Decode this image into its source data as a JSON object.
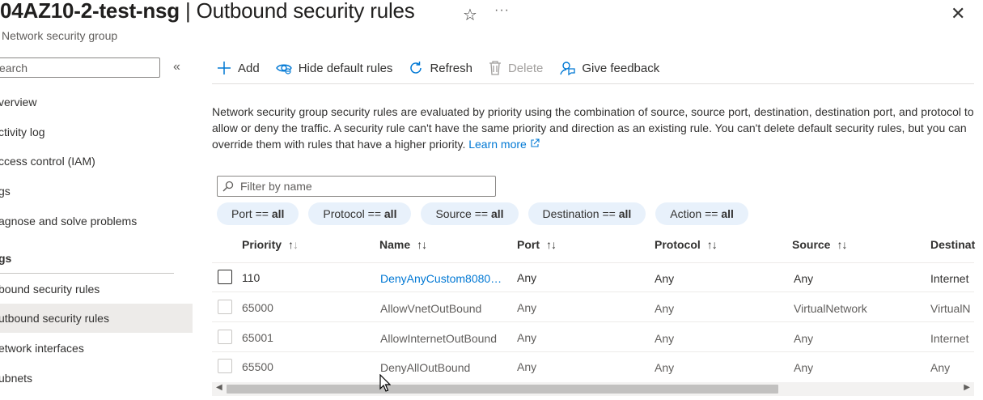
{
  "header": {
    "title_bold": "04AZ10-2-test-nsg",
    "title_rest": " | Outbound security rules",
    "subtitle": "Network security group",
    "star_glyph": "☆",
    "more_glyph": "···",
    "close_glyph": "✕"
  },
  "nav": {
    "search_placeholder": "earch",
    "collapse_glyph": "«",
    "items": [
      {
        "label": "verview"
      },
      {
        "label": "ctivity log"
      },
      {
        "label": "ccess control (IAM)"
      },
      {
        "label": "gs"
      },
      {
        "label": "agnose and solve problems"
      },
      {
        "label": "gs"
      },
      {
        "label": "bound security rules"
      },
      {
        "label": "utbound security rules"
      },
      {
        "label": "etwork interfaces"
      },
      {
        "label": "ubnets"
      }
    ]
  },
  "toolbar": {
    "add": "Add",
    "hide_default": "Hide default rules",
    "refresh": "Refresh",
    "delete": "Delete",
    "feedback": "Give feedback"
  },
  "description": {
    "text": "Network security group security rules are evaluated by priority using the combination of source, source port, destination, destination port, and protocol to allow or deny the traffic. A security rule can't have the same priority and direction as an existing rule. You can't delete default security rules, but you can override them with rules that have a higher priority. ",
    "learn_more": "Learn more"
  },
  "filter": {
    "placeholder": "Filter by name"
  },
  "pills": [
    {
      "key": "Port == ",
      "value": "all"
    },
    {
      "key": "Protocol == ",
      "value": "all"
    },
    {
      "key": "Source == ",
      "value": "all"
    },
    {
      "key": "Destination == ",
      "value": "all"
    },
    {
      "key": "Action == ",
      "value": "all"
    }
  ],
  "table": {
    "columns": [
      "Priority",
      "Name",
      "Port",
      "Protocol",
      "Source",
      "Destinat"
    ],
    "rows": [
      {
        "priority": "110",
        "name": "DenyAnyCustom8080…",
        "port": "Any",
        "protocol": "Any",
        "source": "Any",
        "destination": "Internet"
      },
      {
        "priority": "65000",
        "name": "AllowVnetOutBound",
        "port": "Any",
        "protocol": "Any",
        "source": "VirtualNetwork",
        "destination": "VirtualN"
      },
      {
        "priority": "65001",
        "name": "AllowInternetOutBound",
        "port": "Any",
        "protocol": "Any",
        "source": "Any",
        "destination": "Internet"
      },
      {
        "priority": "65500",
        "name": "DenyAllOutBound",
        "port": "Any",
        "protocol": "Any",
        "source": "Any",
        "destination": "Any"
      }
    ]
  },
  "colors": {
    "accent": "#0078d4",
    "pill_bg": "#e8f1fb",
    "nav_active_bg": "#edebe9"
  }
}
